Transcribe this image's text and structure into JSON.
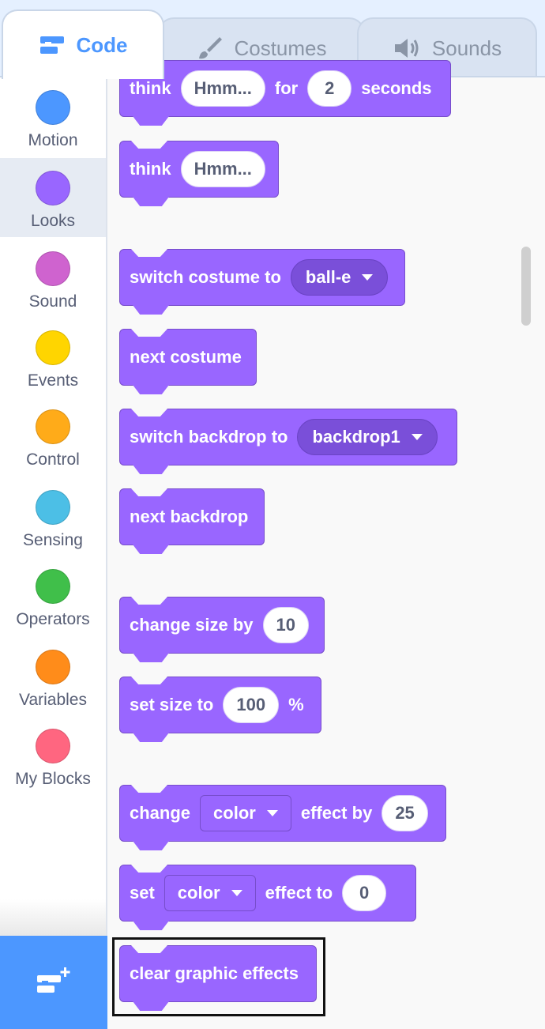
{
  "tabs": {
    "code": "Code",
    "costumes": "Costumes",
    "sounds": "Sounds"
  },
  "categories": [
    {
      "label": "Motion",
      "color": "#4c97ff"
    },
    {
      "label": "Looks",
      "color": "#9966ff"
    },
    {
      "label": "Sound",
      "color": "#cf63cf"
    },
    {
      "label": "Events",
      "color": "#ffd500"
    },
    {
      "label": "Control",
      "color": "#ffab19"
    },
    {
      "label": "Sensing",
      "color": "#4cbfe6"
    },
    {
      "label": "Operators",
      "color": "#40bf4a"
    },
    {
      "label": "Variables",
      "color": "#ff8c1a"
    },
    {
      "label": "My Blocks",
      "color": "#ff6680"
    }
  ],
  "selected_category": "Looks",
  "blocks": {
    "think_for": {
      "w1": "think",
      "input1": "Hmm...",
      "w2": "for",
      "input2": "2",
      "w3": "seconds"
    },
    "think": {
      "w1": "think",
      "input1": "Hmm..."
    },
    "switch_costume": {
      "w1": "switch costume to",
      "menu": "ball-e"
    },
    "next_costume": {
      "w1": "next costume"
    },
    "switch_backdrop": {
      "w1": "switch backdrop to",
      "menu": "backdrop1"
    },
    "next_backdrop": {
      "w1": "next backdrop"
    },
    "change_size": {
      "w1": "change size by",
      "input1": "10"
    },
    "set_size": {
      "w1": "set size to",
      "input1": "100",
      "w2": "%"
    },
    "change_effect": {
      "w1": "change",
      "menu": "color",
      "w2": "effect by",
      "input1": "25"
    },
    "set_effect": {
      "w1": "set",
      "menu": "color",
      "w2": "effect to",
      "input1": "0"
    },
    "clear_effects": {
      "w1": "clear graphic effects"
    }
  },
  "colors": {
    "looks_block": "#9966ff",
    "accent": "#4c97ff"
  }
}
